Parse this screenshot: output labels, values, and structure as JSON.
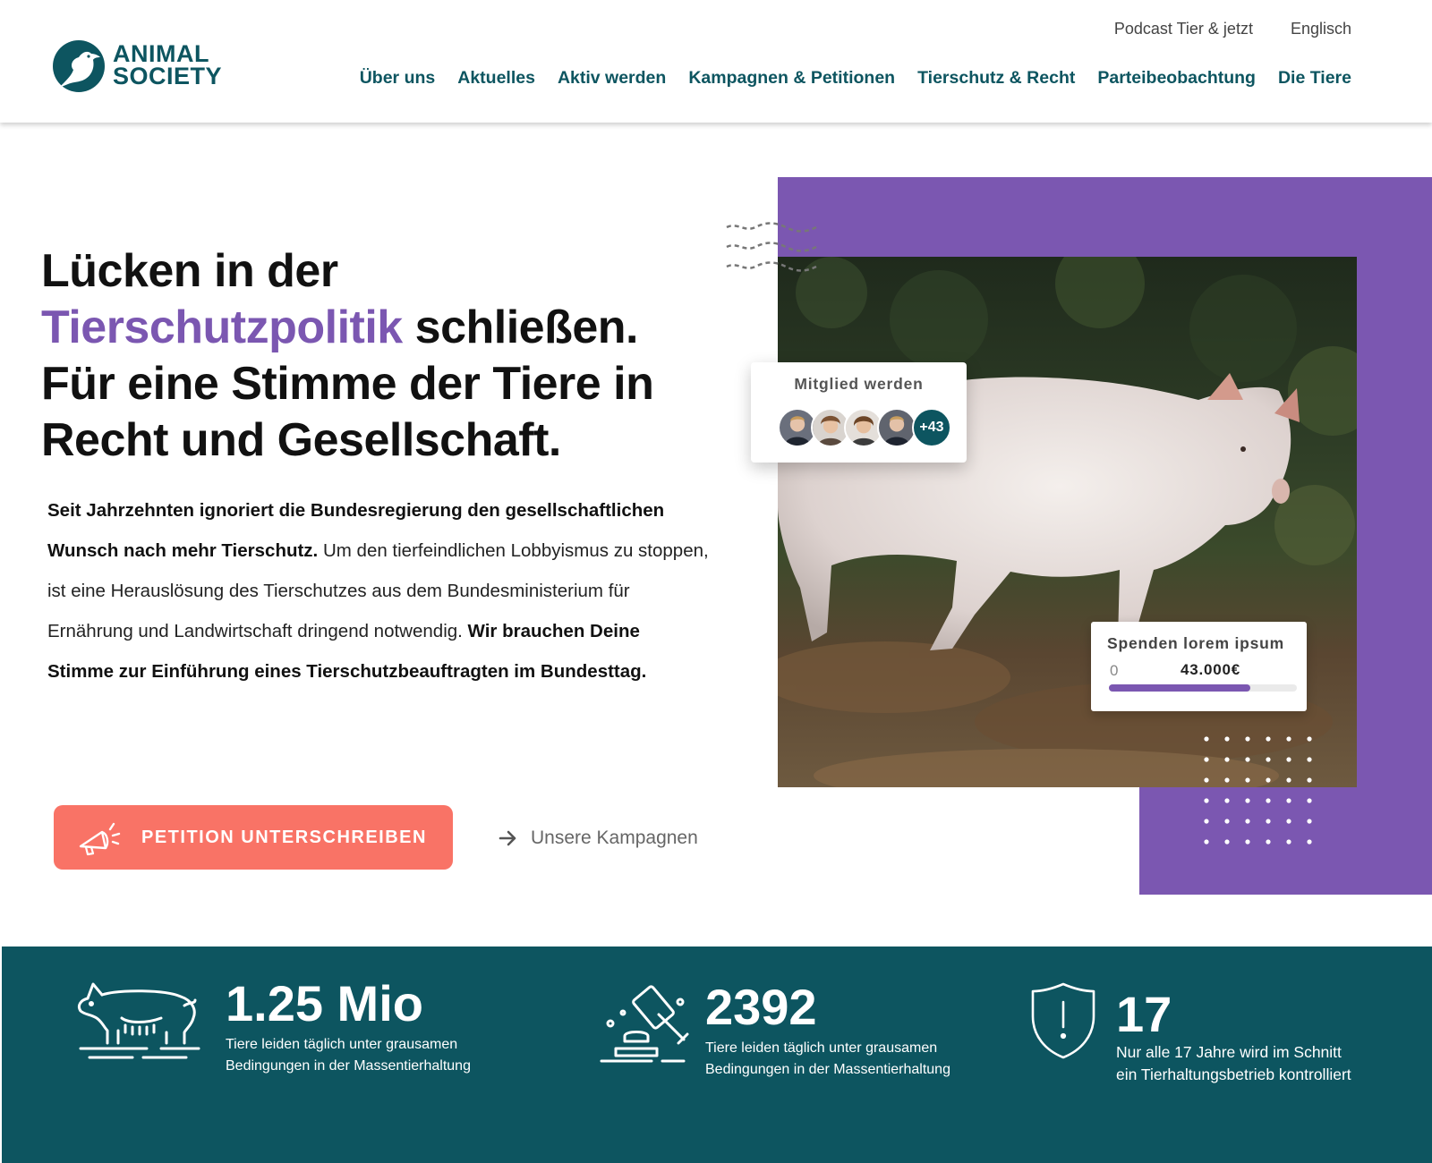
{
  "brand": {
    "name_line1": "ANIMAL",
    "name_line2": "SOCIETY",
    "primary": "#0d5560",
    "accent": "#7b57b1",
    "cta": "#f97366"
  },
  "topnav": {
    "items": [
      {
        "label": "Podcast Tier & jetzt"
      },
      {
        "label": "Englisch"
      }
    ]
  },
  "mainnav": {
    "items": [
      {
        "label": "Über uns"
      },
      {
        "label": "Aktuelles"
      },
      {
        "label": "Aktiv werden"
      },
      {
        "label": "Kampagnen & Petitionen"
      },
      {
        "label": "Tierschutz & Recht"
      },
      {
        "label": "Parteibeobachtung"
      },
      {
        "label": "Die Tiere"
      }
    ]
  },
  "hero": {
    "title_line1": "Lücken in der",
    "title_accent": "Tierschutzpolitik",
    "title_line2_rest": " schließen.",
    "title_line3": "Für eine Stimme der Tiere in",
    "title_line4": "Recht und Gesellschaft.",
    "text_bold1": "Seit Jahrzehnten ignoriert die Bundesregierung den gesellschaftlichen Wunsch nach mehr Tierschutz.",
    "text_regular": " Um den tierfeindlichen Lobbyismus zu stoppen, ist eine Herauslösung des Tierschutzes aus dem Bundesministerium für Ernährung und Landwirtschaft dringend notwendig. ",
    "text_bold2": "Wir brauchen Deine Stimme zur Einführung eines Tierschutzbeauftragten im Bundesttag.",
    "cta_label": "PETITION UNTERSCHREIBEN",
    "secondary_label": "Unsere Kampagnen"
  },
  "member_card": {
    "title": "Mitglied werden",
    "extra_count": "+43"
  },
  "donation_card": {
    "title": "Spenden lorem ipsum",
    "min": "0",
    "amount": "43.000€",
    "progress": 0.75
  },
  "stats": [
    {
      "icon": "pig-icon",
      "value": "1.25 Mio",
      "desc_line1": "Tiere leiden täglich unter grausamen",
      "desc_line2": "Bedingungen in der Massentierhaltung"
    },
    {
      "icon": "gavel-icon",
      "value": "2392",
      "desc_line1": "Tiere leiden täglich unter grausamen",
      "desc_line2": "Bedingungen in der Massentierhaltung"
    },
    {
      "icon": "shield-warning-icon",
      "value": "17",
      "desc_line1": "Nur alle 17 Jahre wird im Schnitt",
      "desc_line2": "ein Tierhaltungsbetrieb kontrolliert"
    }
  ]
}
